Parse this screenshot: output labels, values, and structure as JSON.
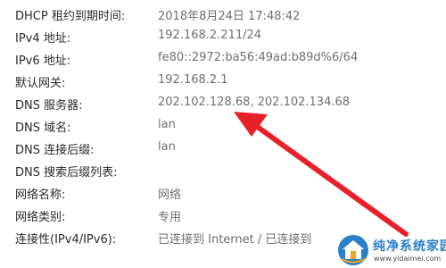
{
  "properties": [
    {
      "label": "DHCP 租约到期时间:",
      "value": "2018年8月24日 17:48:42"
    },
    {
      "label": "IPv4 地址:",
      "value": "192.168.2.211/24"
    },
    {
      "label": "IPv6 地址:",
      "value": "fe80::2972:ba56:49ad:b89d%6/64"
    },
    {
      "label": "默认网关:",
      "value": "192.168.2.1"
    },
    {
      "label": "DNS 服务器:",
      "value": "202.102.128.68, 202.102.134.68"
    },
    {
      "label": "DNS 域名:",
      "value": "lan"
    },
    {
      "label": "DNS 连接后缀:",
      "value": "lan"
    },
    {
      "label": "DNS 搜索后缀列表:",
      "value": ""
    },
    {
      "label": "网络名称:",
      "value": "网络"
    },
    {
      "label": "网络类别:",
      "value": "专用"
    },
    {
      "label": "连接性(IPv4/IPv6):",
      "value": "已连接到 Internet / 已连接到"
    }
  ],
  "annotation": {
    "arrow_color": "#e8202a",
    "arrow_icon": "red-arrow-icon"
  },
  "watermark": {
    "name": "纯净系统家园",
    "url": "www.yidaimei.com",
    "logo_icon": "house-logo-icon"
  }
}
